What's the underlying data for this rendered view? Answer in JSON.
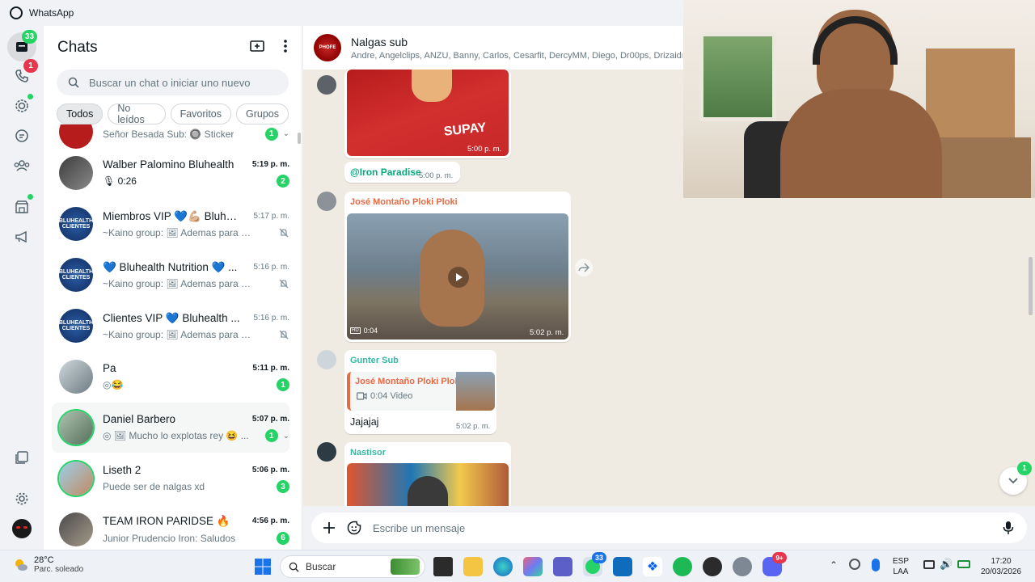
{
  "window": {
    "title": "WhatsApp"
  },
  "rail": {
    "chats_badge": "33",
    "calls_badge": "1"
  },
  "sidebar": {
    "title": "Chats",
    "search_placeholder": "Buscar un chat o iniciar uno nuevo",
    "filters": [
      "Todos",
      "No leídos",
      "Favoritos",
      "Grupos"
    ],
    "chats": [
      {
        "name": "",
        "time": "",
        "preview": "Señor Besada Sub: 🔘 Sticker",
        "unread": "1"
      },
      {
        "name": "Walber Palomino Bluhealth",
        "time": "5:19 p. m.",
        "preview": "0:26",
        "unread": "2"
      },
      {
        "name": "Miembros VIP 💙💪🏼 Bluhe...",
        "time": "5:17 p. m.",
        "preview": "~Kaino group: 🖼 Ademas para qui...",
        "unread": ""
      },
      {
        "name": "💙 Bluhealth Nutrition 💙 ...",
        "time": "5:16 p. m.",
        "preview": "~Kaino group: 🖼 Ademas para qui...",
        "unread": ""
      },
      {
        "name": "Clientes VIP 💙 Bluhealth ...",
        "time": "5:16 p. m.",
        "preview": "~Kaino group: 🖼 Ademas para qui...",
        "unread": ""
      },
      {
        "name": "Pa",
        "time": "5:11 p. m.",
        "preview": "◎😂",
        "unread": "1"
      },
      {
        "name": "Daniel Barbero",
        "time": "5:07 p. m.",
        "preview": "◎ 🖼 Mucho lo explotas rey 😆 ...",
        "unread": "1"
      },
      {
        "name": "Liseth 2",
        "time": "5:06 p. m.",
        "preview": "Puede ser de nalgas xd",
        "unread": "3"
      },
      {
        "name": "TEAM IRON PARIDSE 🔥",
        "time": "4:56 p. m.",
        "preview": "Junior Prudencio Iron: Saludos",
        "unread": "6"
      }
    ]
  },
  "conversation": {
    "group_name": "Nalgas sub",
    "members": "Andre, Angelclips, ANZU, Banny, Carlos, Cesarfit, DercyMM, Diego, Dr00ps, Drizaidre, Ec",
    "messages": [
      {
        "time": "5:00 p. m."
      },
      {
        "mention": "@Iron Paradise",
        "time": "5:00 p. m."
      },
      {
        "sender": "José Montaño Ploki Ploki",
        "duration": "0:04",
        "time": "5:02 p. m."
      },
      {
        "sender": "Gunter Sub",
        "quoted_sender": "José Montaño Ploki Ploki",
        "quoted_text": "0:04 Video",
        "text": "Jajajaj",
        "time": "5:02 p. m."
      },
      {
        "sender": "Nastisor"
      }
    ],
    "scroll_badge": "1",
    "compose_placeholder": "Escribe un mensaje"
  },
  "taskbar": {
    "weather_temp": "28°C",
    "weather_desc": "Parc. soleado",
    "search_label": "Buscar",
    "whatsapp_badge": "33",
    "discord_badge": "9+",
    "lang_1": "ESP",
    "lang_2": "LAA",
    "time": "17:20",
    "date": "20/03/2026"
  },
  "colors": {
    "accent": "#25d366",
    "alert": "#e8364e",
    "sender_green": "#06a77d",
    "sender_orange": "#e36b45",
    "sender_teal": "#35b7a3"
  }
}
